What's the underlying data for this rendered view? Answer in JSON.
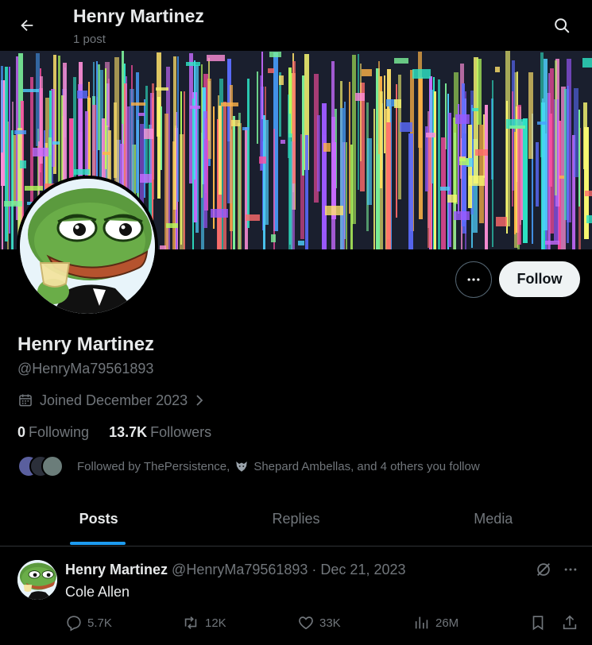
{
  "header": {
    "title": "Henry Martinez",
    "subtitle": "1 post",
    "back_icon": "arrow-left-icon",
    "search_icon": "search-icon"
  },
  "profile": {
    "display_name": "Henry Martinez",
    "handle": "@HenryMa79561893",
    "joined": "Joined December 2023",
    "follow_label": "Follow",
    "following_count": "0",
    "following_label": "Following",
    "followers_count": "13.7K",
    "followers_label": "Followers",
    "followed_by_prefix": "Followed by ThePersistence,",
    "followed_by_suffix": "Shepard Ambellas, and 4 others you follow"
  },
  "tabs": [
    {
      "label": "Posts",
      "active": true
    },
    {
      "label": "Replies",
      "active": false
    },
    {
      "label": "Media",
      "active": false
    }
  ],
  "post": {
    "author": "Henry Martinez",
    "meta": "@HenryMa79561893 · Dec 21, 2023",
    "text": "Cole Allen",
    "replies": "5.7K",
    "reposts": "12K",
    "likes": "33K",
    "views": "26M"
  },
  "colors": {
    "accent": "#1d9bf0",
    "background": "#000000",
    "text": "#e7e9ea",
    "muted": "#71767b"
  }
}
